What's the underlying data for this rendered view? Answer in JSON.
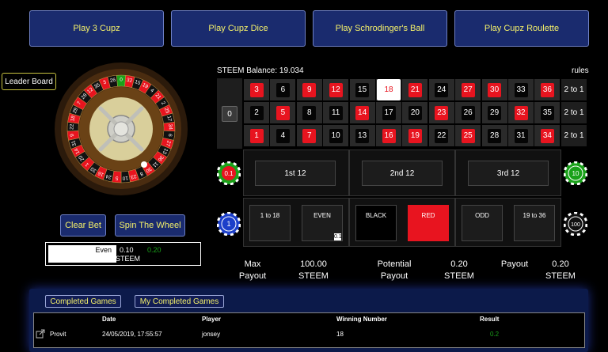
{
  "top_buttons": [
    "Play 3 Cupz",
    "Play Cupz Dice",
    "Play Schrodinger's Ball",
    "Play Cupz Roulette"
  ],
  "leader_board": "Leader Board",
  "balance": "STEEM Balance: 19.034",
  "rules": "rules",
  "board": {
    "zero": "0",
    "rows": [
      [
        {
          "n": "3",
          "c": "red"
        },
        {
          "n": "6",
          "c": "black"
        },
        {
          "n": "9",
          "c": "red"
        },
        {
          "n": "12",
          "c": "red"
        },
        {
          "n": "15",
          "c": "black"
        },
        {
          "n": "18",
          "c": "sel"
        },
        {
          "n": "21",
          "c": "red"
        },
        {
          "n": "24",
          "c": "black"
        },
        {
          "n": "27",
          "c": "red"
        },
        {
          "n": "30",
          "c": "red"
        },
        {
          "n": "33",
          "c": "black"
        },
        {
          "n": "36",
          "c": "red"
        }
      ],
      [
        {
          "n": "2",
          "c": "black"
        },
        {
          "n": "5",
          "c": "red"
        },
        {
          "n": "8",
          "c": "black"
        },
        {
          "n": "11",
          "c": "black"
        },
        {
          "n": "14",
          "c": "red"
        },
        {
          "n": "17",
          "c": "black"
        },
        {
          "n": "20",
          "c": "black"
        },
        {
          "n": "23",
          "c": "red"
        },
        {
          "n": "26",
          "c": "black"
        },
        {
          "n": "29",
          "c": "black"
        },
        {
          "n": "32",
          "c": "red"
        },
        {
          "n": "35",
          "c": "black"
        }
      ],
      [
        {
          "n": "1",
          "c": "red"
        },
        {
          "n": "4",
          "c": "black"
        },
        {
          "n": "7",
          "c": "red"
        },
        {
          "n": "10",
          "c": "black"
        },
        {
          "n": "13",
          "c": "black"
        },
        {
          "n": "16",
          "c": "red"
        },
        {
          "n": "19",
          "c": "red"
        },
        {
          "n": "22",
          "c": "black"
        },
        {
          "n": "25",
          "c": "red"
        },
        {
          "n": "28",
          "c": "black"
        },
        {
          "n": "31",
          "c": "black"
        },
        {
          "n": "34",
          "c": "red"
        }
      ]
    ],
    "column_bets": [
      "2 to 1",
      "2 to 1",
      "2 to 1"
    ],
    "dozens": [
      "1st 12",
      "2nd 12",
      "3rd 12"
    ],
    "outside": [
      "1 to 18",
      "EVEN",
      "BLACK",
      "RED",
      "ODD",
      "19 to 36"
    ],
    "even_chip": "0.1"
  },
  "chips": [
    "0.1",
    "10",
    "1",
    "100"
  ],
  "clear_bet": "Clear Bet",
  "spin": "Spin The Wheel",
  "bet_line": {
    "name": "Even",
    "amount": "0.10",
    "payout": "0.20",
    "currency": "STEEM"
  },
  "payout_info": {
    "max_label": "Max Payout",
    "max_value": "100.00 STEEM",
    "potential_label": "Potential Payout",
    "potential_value": "0.20 STEEM",
    "payout_label": "Payout",
    "payout_value": "0.20 STEEM"
  },
  "tabs": [
    "Completed Games",
    "My Completed Games"
  ],
  "table": {
    "headers": [
      "Date",
      "Player",
      "Winning Number",
      "Result"
    ],
    "rows": [
      {
        "game": "Provit",
        "date": "24/05/2019, 17:55:57",
        "player": "jonsey",
        "winning": "18",
        "result": "0.2"
      }
    ]
  },
  "wheel_numbers": [
    "0",
    "32",
    "15",
    "19",
    "4",
    "21",
    "2",
    "25",
    "17",
    "34",
    "6",
    "27",
    "13",
    "36",
    "11",
    "30",
    "8",
    "23",
    "10",
    "5",
    "24",
    "16",
    "33",
    "1",
    "20",
    "14",
    "31",
    "9",
    "22",
    "18",
    "29",
    "7",
    "28",
    "12",
    "35",
    "3",
    "26"
  ],
  "colors": {
    "button_bg": "#1a2b6e",
    "button_text": "#f4f06a",
    "red": "#e8141f",
    "green": "#1aa11a"
  }
}
